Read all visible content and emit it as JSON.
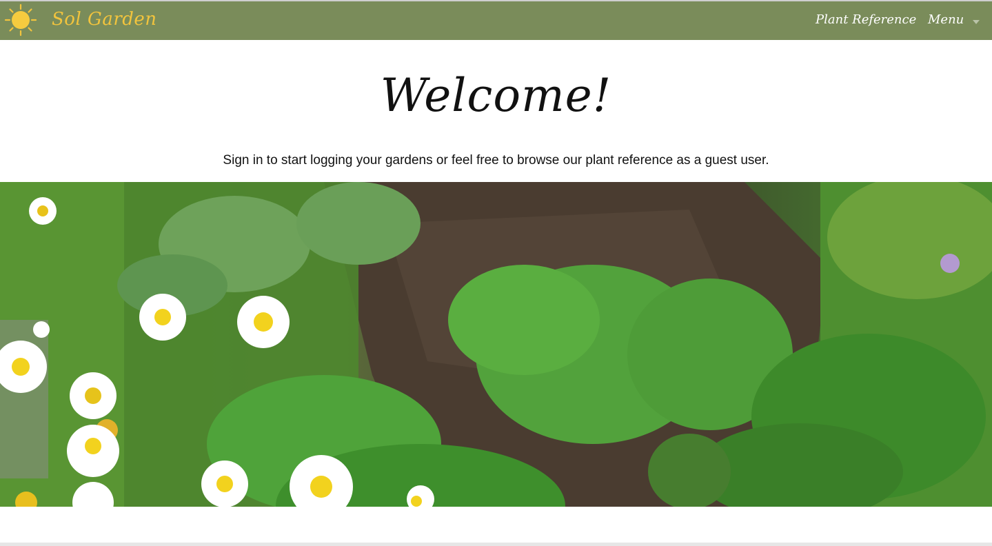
{
  "header": {
    "brand": "Sol Garden",
    "nav": {
      "plant_reference": "Plant Reference",
      "menu": "Menu"
    }
  },
  "main": {
    "title": "Welcome!",
    "subtitle": "Sign in to start logging your gardens or feel free to browse our plant reference as a guest user."
  },
  "colors": {
    "navbar": "#7a8c5a",
    "brand": "#f2c43d"
  },
  "icons": {
    "logo": "sun-icon",
    "menu_caret": "chevron-down-icon"
  }
}
